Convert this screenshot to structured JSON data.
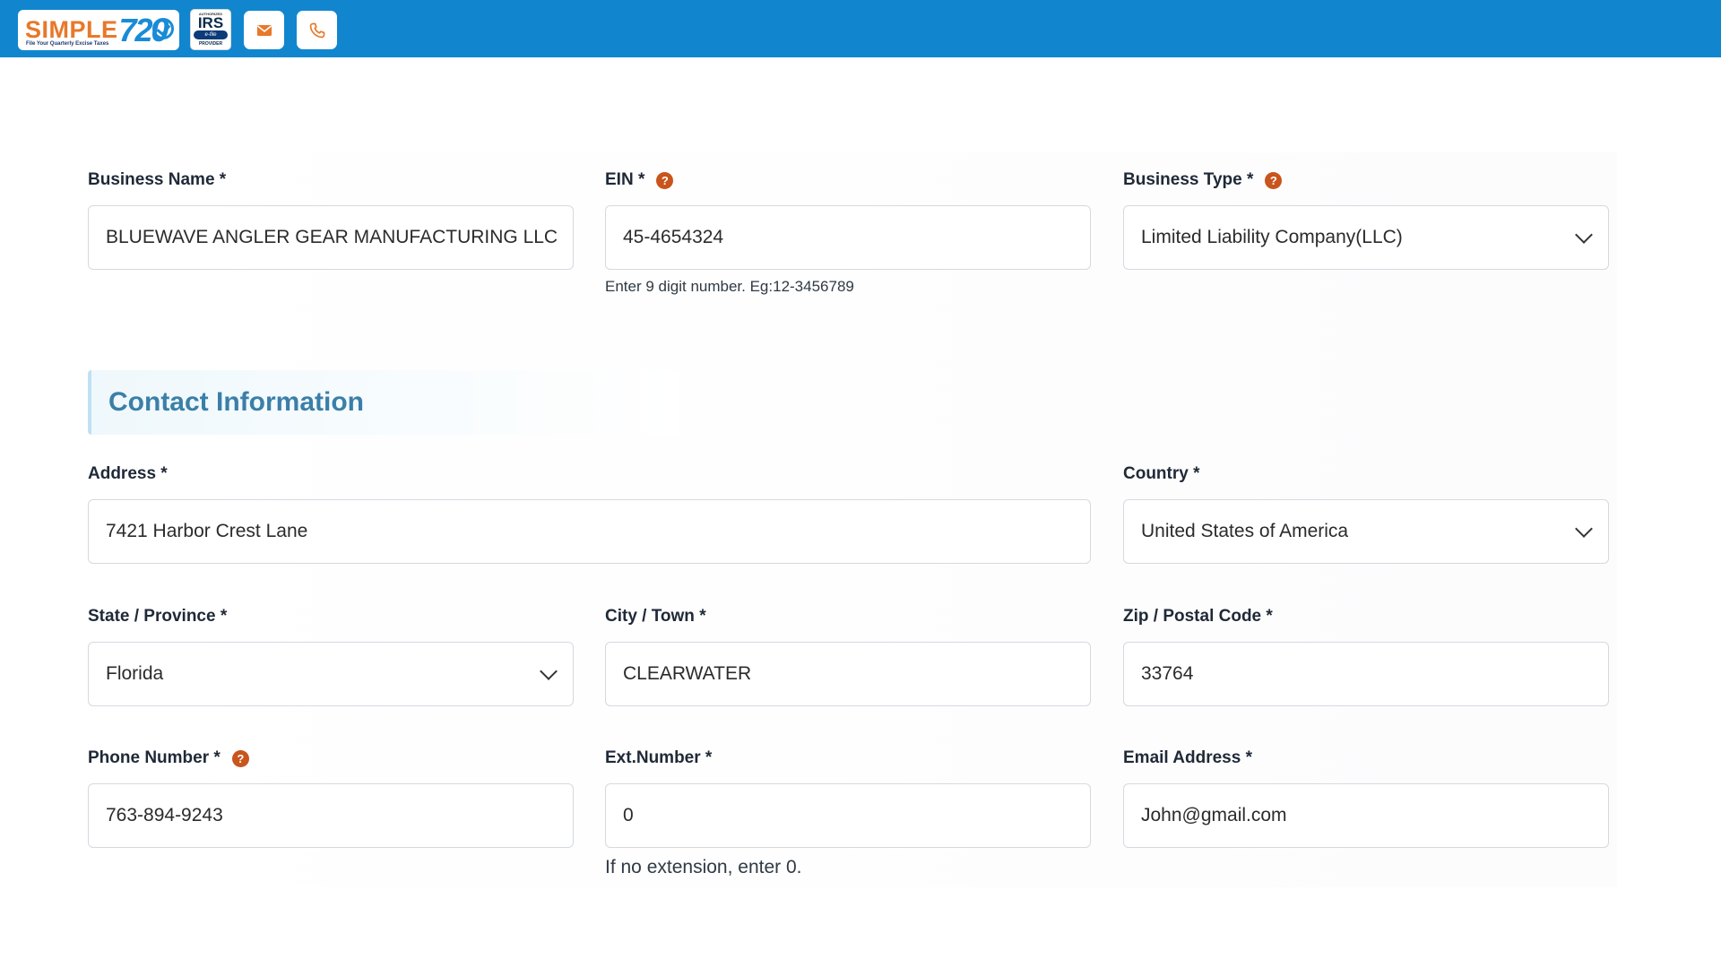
{
  "header": {
    "logo_word": "SIMPLE",
    "logo_number": "720",
    "logo_tagline": "File Your Quarterly Excise Taxes",
    "badge_authorized": "AUTHORIZED",
    "badge_irs": "IRS",
    "badge_efile": "e-file",
    "badge_provider": "PROVIDER",
    "email_icon": "envelope-icon",
    "phone_icon": "phone-icon",
    "bar_color": "#1186cf"
  },
  "business": {
    "name_label": "Business Name *",
    "name_value": "BLUEWAVE ANGLER GEAR MANUFACTURING LLC",
    "ein_label": "EIN *",
    "ein_value": "45-4654324",
    "ein_hint": "Enter 9 digit number. Eg:12-3456789",
    "type_label": "Business Type *",
    "type_value": "Limited Liability Company(LLC)"
  },
  "contact": {
    "section_title": "Contact Information",
    "address_label": "Address *",
    "address_value": "7421 Harbor Crest Lane",
    "country_label": "Country *",
    "country_value": "United States of America",
    "state_label": "State / Province *",
    "state_value": "Florida",
    "city_label": "City / Town *",
    "city_value": "CLEARWATER",
    "zip_label": "Zip / Postal Code *",
    "zip_value": "33764",
    "phone_label": "Phone Number *",
    "phone_value": "763-894-9243",
    "ext_label": "Ext.Number *",
    "ext_value": "0",
    "ext_hint": "If no extension, enter 0.",
    "email_label": "Email Address *",
    "email_value": "John@gmail.com"
  },
  "help_glyph": "?",
  "accent_color": "#c9541c"
}
